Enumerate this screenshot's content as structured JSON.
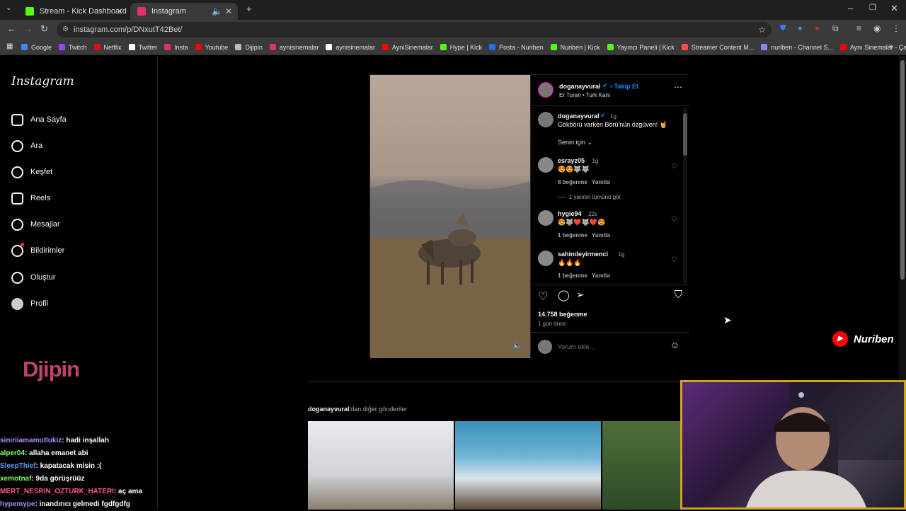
{
  "browser": {
    "tabs": [
      {
        "title": "Stream - Kick Dashboard",
        "favicon_color": "#53fc18"
      },
      {
        "title": "Instagram",
        "favicon_color": "#e1306c"
      }
    ],
    "url": "instagram.com/p/DNxutT42Bet/",
    "bookmarks": [
      {
        "label": "Google",
        "color": "#4285f4"
      },
      {
        "label": "Twitch",
        "color": "#9146ff"
      },
      {
        "label": "Netflix",
        "color": "#e50914"
      },
      {
        "label": "Twitter",
        "color": "#ffffff"
      },
      {
        "label": "Insta",
        "color": "#e1306c"
      },
      {
        "label": "Youtube",
        "color": "#ff0000"
      },
      {
        "label": "Dijipin",
        "color": "#bbbbbb"
      },
      {
        "label": "aynisinemalar",
        "color": "#e1306c"
      },
      {
        "label": "aynisinemalar",
        "color": "#ffffff"
      },
      {
        "label": "AyniSinemalar",
        "color": "#ff0000"
      },
      {
        "label": "Hype | Kick",
        "color": "#53fc18"
      },
      {
        "label": "Posta - Nuriben",
        "color": "#1a73e8"
      },
      {
        "label": "Nuriben | Kick",
        "color": "#53fc18"
      },
      {
        "label": "Yayıncı Paneli | Kick",
        "color": "#53fc18"
      },
      {
        "label": "Streamer Content M...",
        "color": "#ff4b4b"
      },
      {
        "label": "nuriben - Channel S...",
        "color": "#8888ff"
      },
      {
        "label": "Aynı Sinemalar - Ça...",
        "color": "#ff0000"
      }
    ]
  },
  "sidebar": {
    "logo": "Instagram",
    "items": [
      {
        "label": "Ana Sayfa",
        "icon": "home-icon"
      },
      {
        "label": "Ara",
        "icon": "search-icon"
      },
      {
        "label": "Keşfet",
        "icon": "compass-icon"
      },
      {
        "label": "Reels",
        "icon": "reels-icon"
      },
      {
        "label": "Mesajlar",
        "icon": "messenger-icon"
      },
      {
        "label": "Bildirimler",
        "icon": "heart-icon"
      },
      {
        "label": "Oluştur",
        "icon": "plus-icon"
      },
      {
        "label": "Profil",
        "icon": "avatar-icon"
      }
    ],
    "overlay_logo": "Djipin"
  },
  "post": {
    "author": "doganayvural",
    "follow": "Takip Et",
    "audio": "Er Turan • Turk Kani",
    "caption_author": "doganayvural",
    "caption_time": "1g",
    "caption": "Gökbörü varken Börü'nün özgüven! 🤘",
    "sort_label": "Senin için",
    "comments": [
      {
        "user": "esrayz05",
        "time": "1g",
        "text": "😍😍🐺🐺",
        "likes": "8 beğenme",
        "reply": "Yanıtla"
      },
      {
        "user": "hygie94",
        "time": "22s",
        "text": "😍🐺❤️🐺❤️😍",
        "likes": "1 beğenme",
        "reply": "Yanıtla"
      },
      {
        "user": "sahindeyirmenci",
        "time": "1g",
        "text": "🔥🔥🔥",
        "likes": "1 beğenme",
        "reply": "Yanıtla"
      }
    ],
    "view_replies": "1 yanıtın tümünü gör",
    "likes": "14.758 beğenme",
    "date": "1 gün önce",
    "comment_placeholder": "Yorum ekle..."
  },
  "more_posts": {
    "author": "doganayvural",
    "suffix": "'dan diğer gönderiler"
  },
  "overlay": {
    "brand": "Nuriben",
    "chat": [
      {
        "user": "siniriiamamutlukiz",
        "message": ": hadi inşallah",
        "color": "#b18cff"
      },
      {
        "user": "alper04",
        "message": ": allaha emanet abi",
        "color": "#7fff6b"
      },
      {
        "user": "SleepThief",
        "message": ": kapatacak misin :(",
        "color": "#5aa0ff"
      },
      {
        "user": "xemotnaf",
        "message": ": 9da görüşrüüz",
        "color": "#7fff6b"
      },
      {
        "user": "MERT_NESRIN_OZTURK_HATERI",
        "message": ": aç ama",
        "color": "#ff5a8a"
      },
      {
        "user": "hypemype",
        "message": ": inandırıcı gelmedi fgdfgdfg",
        "color": "#b18cff"
      }
    ]
  }
}
